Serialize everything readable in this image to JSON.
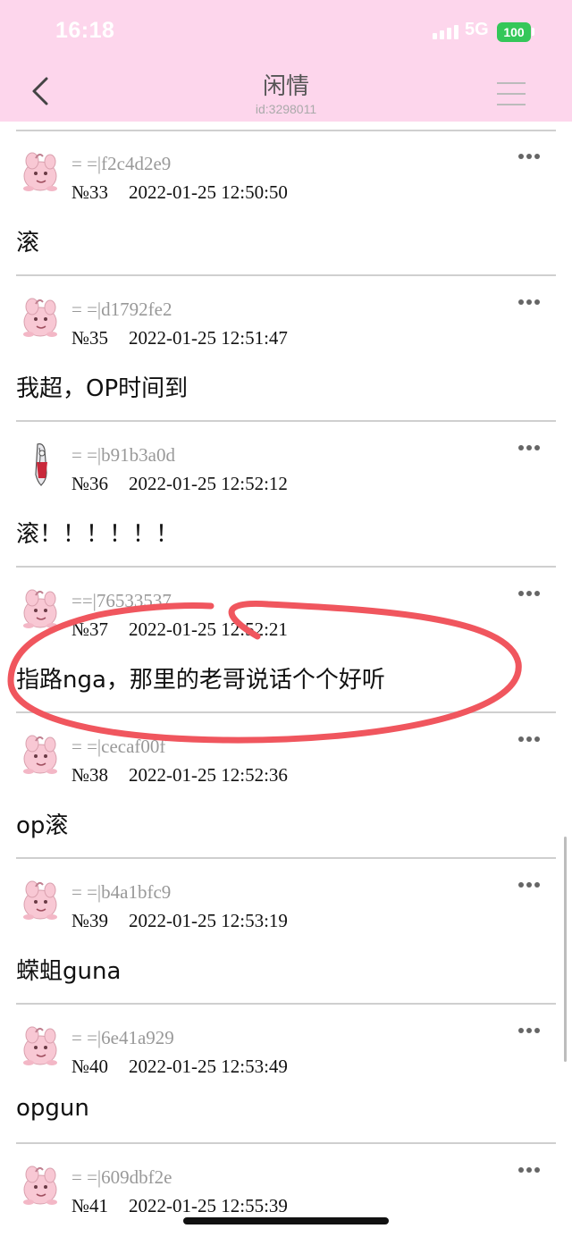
{
  "status_bar": {
    "time": "16:18",
    "network": "5G",
    "battery": "100"
  },
  "header": {
    "title": "闲情",
    "subtitle": "id:3298011"
  },
  "icons": {
    "back": "chevron-left-icon",
    "menu": "hamburger-menu-icon",
    "more": "more-horizontal-icon"
  },
  "colors": {
    "header_bg": "#fdd6ec",
    "annotation_circle": "#f0565e"
  },
  "posts": [
    {
      "author": "= =|f2c4d2e9",
      "floor": "№33",
      "time": "2022-01-25 12:50:50",
      "content": "滚"
    },
    {
      "author": "= =|d1792fe2",
      "floor": "№35",
      "time": "2022-01-25 12:51:47",
      "content": "我超，OP时间到"
    },
    {
      "author": "= =|b91b3a0d",
      "floor": "№36",
      "time": "2022-01-25 12:52:12",
      "content": "滚！！！！！！"
    },
    {
      "author": "==|76533537",
      "floor": "№37",
      "time": "2022-01-25 12:52:21",
      "content": "指路nga，那里的老哥说话个个好听"
    },
    {
      "author": "= =|cecaf00f",
      "floor": "№38",
      "time": "2022-01-25 12:52:36",
      "content": "op滚"
    },
    {
      "author": "= =|b4a1bfc9",
      "floor": "№39",
      "time": "2022-01-25 12:53:19",
      "content": "蝾蛆guna"
    },
    {
      "author": "= =|6e41a929",
      "floor": "№40",
      "time": "2022-01-25 12:53:49",
      "content": "opgun"
    },
    {
      "author": "= =|609dbf2e",
      "floor": "№41",
      "time": "2022-01-25 12:55:39",
      "content": ""
    }
  ]
}
